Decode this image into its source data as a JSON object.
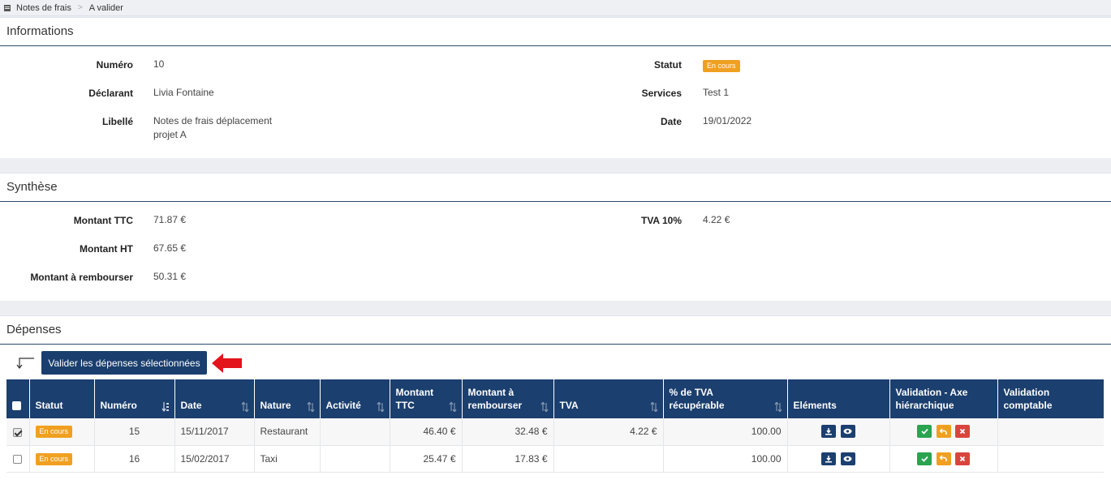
{
  "breadcrumb": {
    "items": [
      "Notes de frais",
      "A valider"
    ],
    "separator": ">"
  },
  "informations": {
    "title": "Informations",
    "numero_label": "Numéro",
    "numero": "10",
    "declarant_label": "Déclarant",
    "declarant": "Livia Fontaine",
    "libelle_label": "Libellé",
    "libelle_line1": "Notes de frais déplacement",
    "libelle_line2": "projet A",
    "statut_label": "Statut",
    "statut": "En cours",
    "services_label": "Services",
    "services": "Test 1",
    "date_label": "Date",
    "date": "19/01/2022"
  },
  "synthese": {
    "title": "Synthèse",
    "ttc_label": "Montant TTC",
    "ttc": "71.87 €",
    "ht_label": "Montant HT",
    "ht": "67.65 €",
    "rembourser_label": "Montant à rembourser",
    "rembourser": "50.31 €",
    "tva_label": "TVA 10%",
    "tva": "4.22 €"
  },
  "depenses": {
    "title": "Dépenses",
    "valider_button": "Valider les dépenses sélectionnées",
    "columns": {
      "statut": "Statut",
      "numero": "Numéro",
      "date": "Date",
      "nature": "Nature",
      "activite": "Activité",
      "ttc1": "Montant",
      "ttc2": "TTC",
      "remb1": "Montant à",
      "remb2": "rembourser",
      "tva": "TVA",
      "pct1": "% de TVA",
      "pct2": "récupérable",
      "elements": "Eléments",
      "vh1": "Validation - Axe",
      "vh2": "hiérarchique",
      "vc1": "Validation",
      "vc2": "comptable"
    },
    "rows": [
      {
        "checked": true,
        "statut": "En cours",
        "numero": "15",
        "date": "15/11/2017",
        "nature": "Restaurant",
        "activite": "",
        "ttc": "46.40 €",
        "rembourser": "32.48 €",
        "tva": "4.22 €",
        "pct": "100.00"
      },
      {
        "checked": false,
        "statut": "En cours",
        "numero": "16",
        "date": "15/02/2017",
        "nature": "Taxi",
        "activite": "",
        "ttc": "25.47 €",
        "rembourser": "17.83 €",
        "tva": "",
        "pct": "100.00"
      }
    ]
  },
  "colors": {
    "primary": "#1b3f6e",
    "badge": "#f0a020",
    "green": "#2aa44f",
    "red": "#d9453d",
    "red_arrow": "#e3141b"
  },
  "icons": [
    "home-icon",
    "download-icon",
    "eye-icon",
    "check-icon",
    "undo-icon",
    "close-icon",
    "return-arrow-icon",
    "red-arrow-icon",
    "sort-icon"
  ]
}
